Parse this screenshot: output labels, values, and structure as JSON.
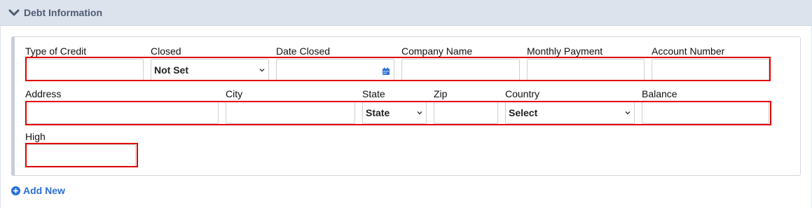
{
  "section": {
    "title": "Debt Information"
  },
  "row1": {
    "type_of_credit": {
      "label": "Type of Credit",
      "value": ""
    },
    "closed": {
      "label": "Closed",
      "selected": "Not Set"
    },
    "date_closed": {
      "label": "Date Closed",
      "value": ""
    },
    "company_name": {
      "label": "Company Name",
      "value": ""
    },
    "monthly_payment": {
      "label": "Monthly Payment",
      "value": ""
    },
    "account_number": {
      "label": "Account Number",
      "value": ""
    }
  },
  "row2": {
    "address": {
      "label": "Address",
      "value": ""
    },
    "city": {
      "label": "City",
      "value": ""
    },
    "state": {
      "label": "State",
      "selected": "State"
    },
    "zip": {
      "label": "Zip",
      "value": ""
    },
    "country": {
      "label": "Country",
      "selected": "Select"
    },
    "balance": {
      "label": "Balance",
      "value": ""
    }
  },
  "row3": {
    "high": {
      "label": "High",
      "value": ""
    }
  },
  "actions": {
    "add_new": "Add New"
  },
  "colors": {
    "accent": "#2a6fd6",
    "highlight": "#e00000",
    "header_bg": "#dde3ec",
    "header_text": "#4d5b73"
  },
  "icons": {
    "header": "chevron-down-icon",
    "date": "calendar-icon",
    "add": "plus-circle-icon"
  }
}
